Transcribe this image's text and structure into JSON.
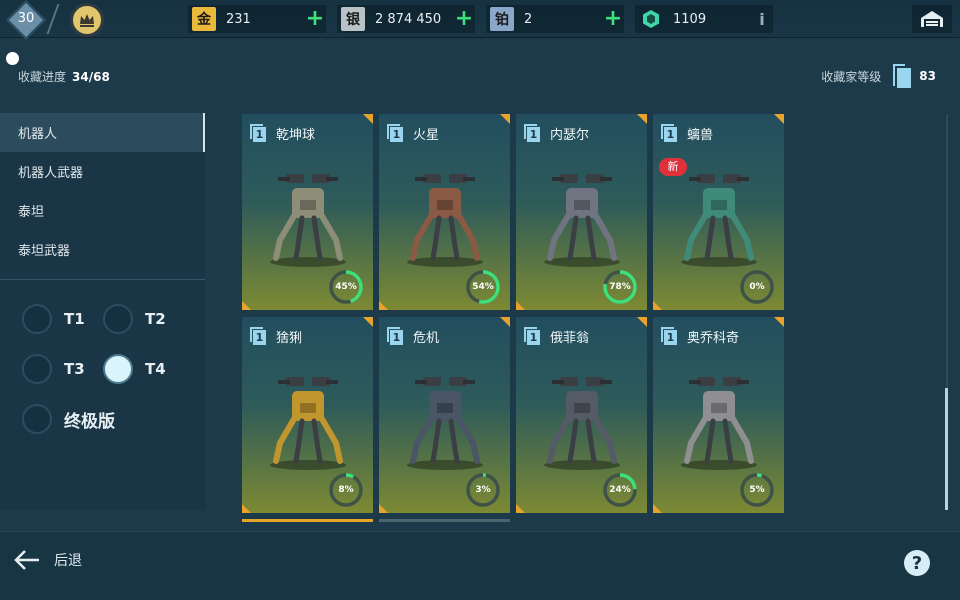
{
  "player": {
    "level": "30"
  },
  "currencies": [
    {
      "name": "gold",
      "icon_char": "金",
      "value": "231",
      "color": "#e8b93a",
      "action": "+"
    },
    {
      "name": "silver",
      "icon_char": "银",
      "value": "2 874 450",
      "color": "#b9c2c7",
      "action": "+"
    },
    {
      "name": "platinum",
      "icon_char": "铂",
      "value": "2",
      "color": "#8aa6c8",
      "action": "+"
    },
    {
      "name": "key",
      "icon_char": "",
      "value": "1109",
      "color": "#3fd6a9",
      "action": "i"
    }
  ],
  "progress": {
    "label": "收藏进度",
    "value": "34/68"
  },
  "collector": {
    "label": "收藏家等级",
    "value": "83"
  },
  "categories": [
    {
      "label": "机器人",
      "active": true
    },
    {
      "label": "机器人武器",
      "active": false
    },
    {
      "label": "泰坦",
      "active": false
    },
    {
      "label": "泰坦武器",
      "active": false
    }
  ],
  "tiers": [
    {
      "label": "T1",
      "selected": false
    },
    {
      "label": "T2",
      "selected": false
    },
    {
      "label": "T3",
      "selected": false
    },
    {
      "label": "T4",
      "selected": true
    },
    {
      "label": "终极版",
      "selected": false
    }
  ],
  "robots": [
    {
      "tier": "1",
      "name": "乾坤球",
      "percent": 45,
      "percent_label": "45%",
      "is_new": false,
      "color": "#8d8d78"
    },
    {
      "tier": "1",
      "name": "火星",
      "percent": 54,
      "percent_label": "54%",
      "is_new": false,
      "color": "#8a5a44"
    },
    {
      "tier": "1",
      "name": "内瑟尔",
      "percent": 78,
      "percent_label": "78%",
      "is_new": false,
      "color": "#6f7480"
    },
    {
      "tier": "1",
      "name": "螭兽",
      "percent": 0,
      "percent_label": "0%",
      "is_new": true,
      "new_label": "新",
      "color": "#3f8a78"
    },
    {
      "tier": "1",
      "name": "猞猁",
      "percent": 8,
      "percent_label": "8%",
      "is_new": false,
      "color": "#c2962e"
    },
    {
      "tier": "1",
      "name": "危机",
      "percent": 3,
      "percent_label": "3%",
      "is_new": false,
      "color": "#4a5566"
    },
    {
      "tier": "1",
      "name": "俄菲翁",
      "percent": 24,
      "percent_label": "24%",
      "is_new": false,
      "color": "#555b66"
    },
    {
      "tier": "1",
      "name": "奥乔科奇",
      "percent": 5,
      "percent_label": "5%",
      "is_new": false,
      "color": "#8f8f92"
    }
  ],
  "bottom": {
    "back_label": "后退",
    "help_label": "?"
  },
  "colors": {
    "accent_green": "#3ee07a",
    "ring_bg": "#3f5248",
    "card_corner": "#e8a32a"
  }
}
